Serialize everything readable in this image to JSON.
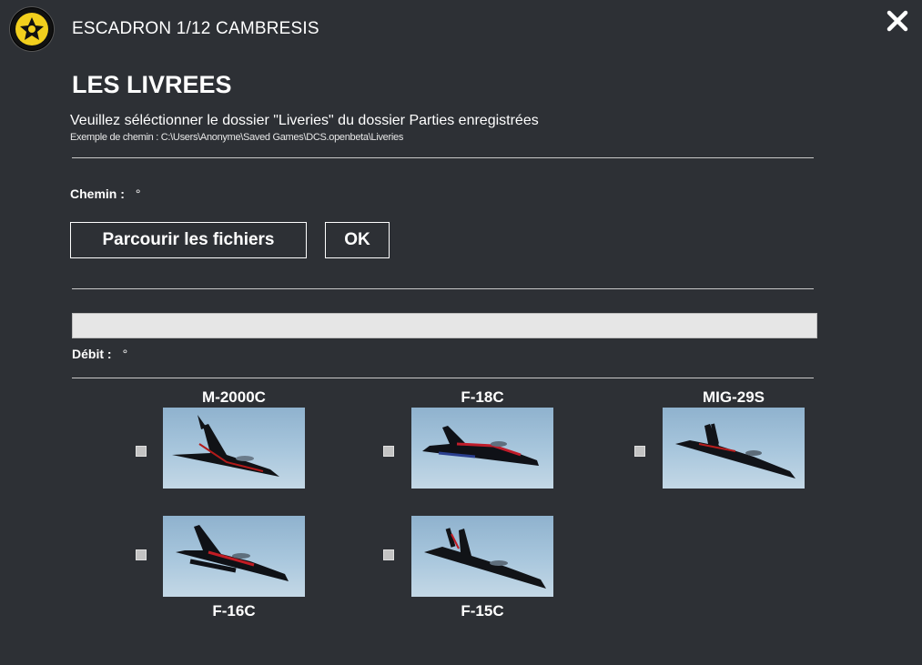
{
  "header": {
    "title": "ESCADRON 1/12 CAMBRESIS",
    "logo_icon": "squadron-emblem-icon",
    "close_icon": "close-icon"
  },
  "section": {
    "title": "LES LIVREES",
    "instructions": "Veuillez séléctionner le dossier \"Liveries\" du dossier Parties enregistrées",
    "path_example": "Exemple de chemin : C:\\Users\\Anonyme\\Saved Games\\DCS.openbeta\\Liveries"
  },
  "path": {
    "label": "Chemin :",
    "value": "°"
  },
  "buttons": {
    "browse": "Parcourir les fichiers",
    "ok": "OK"
  },
  "progress": {
    "value": 0,
    "label": "Débit :",
    "rate": "°"
  },
  "aircraft": [
    {
      "name": "M-2000C",
      "checked": false
    },
    {
      "name": "F-18C",
      "checked": false
    },
    {
      "name": "MIG-29S",
      "checked": false
    },
    {
      "name": "F-16C",
      "checked": false
    },
    {
      "name": "F-15C",
      "checked": false
    }
  ],
  "colors": {
    "background": "#2d3035",
    "text": "#ffffff",
    "divider": "#c9c9c9",
    "progress_track": "#e6e6e6",
    "accent": "#f2cf1d"
  }
}
